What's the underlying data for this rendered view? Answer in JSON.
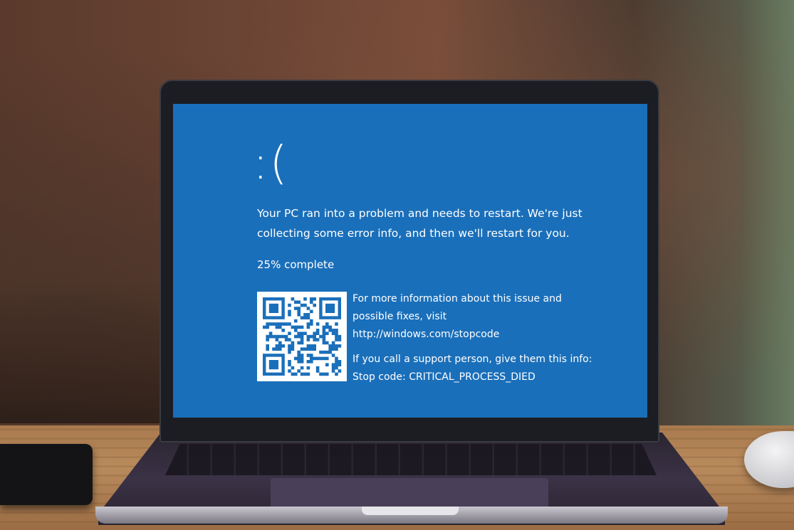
{
  "screen": {
    "background_color": "#1a6fba",
    "sad_face": ":(",
    "message": "Your PC ran into a problem and needs to restart. We're just collecting some error info, and then we'll restart for you.",
    "progress": {
      "value_percent": 25,
      "label": "25% complete"
    },
    "qr_code_icon": "qr-code-icon",
    "info": {
      "line1": "For more information about this issue and",
      "line2": "possible fixes, visit",
      "url": "http://windows.com/stopcode",
      "support_line": "If you call a support person, give them this info:",
      "stop_code": "Stop code: CRITICAL_PROCESS_DIED"
    }
  }
}
